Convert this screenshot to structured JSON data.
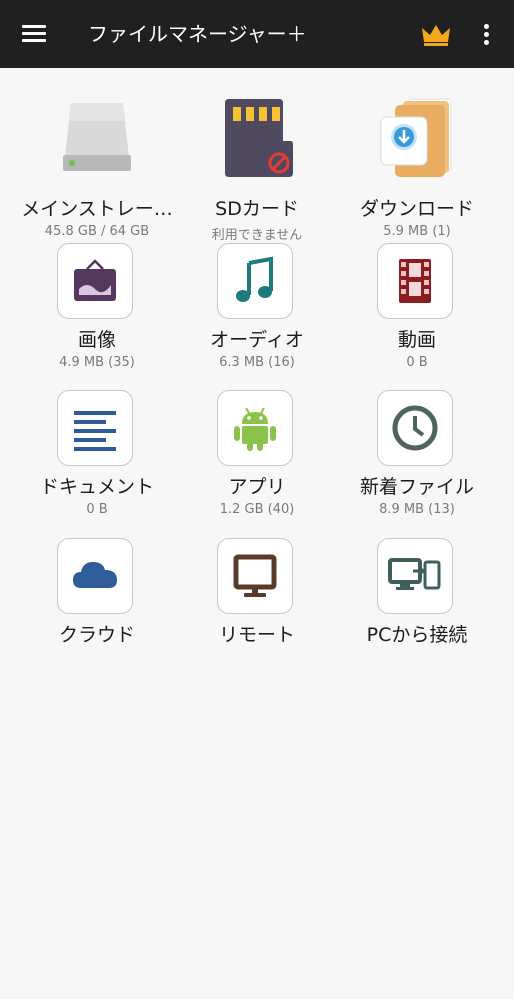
{
  "appbar": {
    "title": "ファイルマネージャー＋",
    "menu_icon": "menu-icon",
    "premium_icon": "crown-icon",
    "more_icon": "more-vert-icon"
  },
  "colors": {
    "appbar_bg": "#202020",
    "background": "#f7f7f7",
    "crown": "#f2a91b"
  },
  "tiles": [
    {
      "label": "メインストレー…",
      "sub": "45.8 GB / 64 GB",
      "icon": "hard-drive-icon"
    },
    {
      "label": "SDカード",
      "sub": "利用できません",
      "icon": "sd-card-icon"
    },
    {
      "label": "ダウンロード",
      "sub": "5.9 MB (1)",
      "icon": "download-folder-icon"
    },
    {
      "label": "画像",
      "sub": "4.9 MB (35)",
      "icon": "image-icon"
    },
    {
      "label": "オーディオ",
      "sub": "6.3 MB (16)",
      "icon": "music-note-icon"
    },
    {
      "label": "動画",
      "sub": "0 B",
      "icon": "film-icon"
    },
    {
      "label": "ドキュメント",
      "sub": "0 B",
      "icon": "document-icon"
    },
    {
      "label": "アプリ",
      "sub": "1.2 GB (40)",
      "icon": "android-icon"
    },
    {
      "label": "新着ファイル",
      "sub": "8.9 MB (13)",
      "icon": "clock-icon"
    },
    {
      "label": "クラウド",
      "icon": "cloud-icon"
    },
    {
      "label": "リモート",
      "icon": "monitor-icon"
    },
    {
      "label": "PCから接続",
      "icon": "pc-connect-icon"
    }
  ]
}
